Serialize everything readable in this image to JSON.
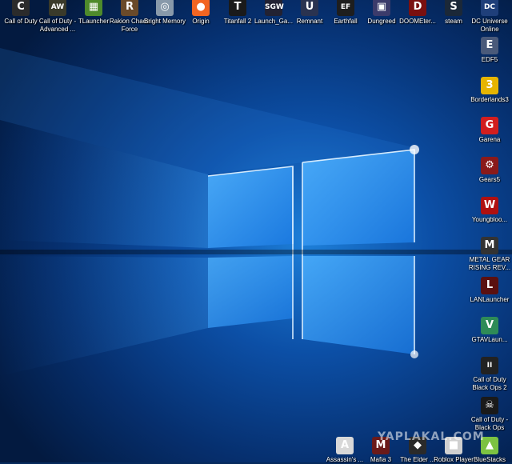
{
  "desktop": {
    "top_icons": [
      {
        "label": "Call of Duty",
        "icon": "cod-icon",
        "color": "#2b2b2b",
        "glyph": "C"
      },
      {
        "label": "Call of Duty - Advanced ...",
        "icon": "cod-aw-icon",
        "color": "#3a3a2a",
        "glyph": "AW"
      },
      {
        "label": "TLauncher",
        "icon": "minecraft-block-icon",
        "color": "#4e8a2b",
        "glyph": "▦"
      },
      {
        "label": "Rakion Chaos Force",
        "icon": "rakion-icon",
        "color": "#6a4a2a",
        "glyph": "R"
      },
      {
        "label": "Bright Memory",
        "icon": "bright-memory-icon",
        "color": "#8899aa",
        "glyph": "◎"
      },
      {
        "label": "Origin",
        "icon": "origin-icon",
        "color": "#f26522",
        "glyph": "●"
      },
      {
        "label": "Titanfall 2",
        "icon": "titanfall-icon",
        "color": "#1a1a1a",
        "glyph": "T"
      },
      {
        "label": "Launch_Ga...",
        "icon": "sgw-icon",
        "color": "#222233",
        "glyph": "SGW"
      },
      {
        "label": "Remnant",
        "icon": "unreal-icon",
        "color": "#2a3350",
        "glyph": "U"
      },
      {
        "label": "Earthfall",
        "icon": "earthfall-icon",
        "color": "#1e1e1e",
        "glyph": "EF"
      },
      {
        "label": "Dungreed",
        "icon": "dungreed-icon",
        "color": "#3b3b6b",
        "glyph": "▣"
      },
      {
        "label": "DOOMEter...",
        "icon": "doom-icon",
        "color": "#7a1010",
        "glyph": "D"
      },
      {
        "label": "steam",
        "icon": "steam-icon",
        "color": "#1b2838",
        "glyph": "S"
      },
      {
        "label": "DC Universe Online",
        "icon": "dc-icon",
        "color": "#1f3f7a",
        "glyph": "DC"
      }
    ],
    "right_icons": [
      {
        "label": "EDF5",
        "icon": "edf5-icon",
        "color": "#4a5a7a",
        "glyph": "E"
      },
      {
        "label": "Borderlands3",
        "icon": "borderlands-icon",
        "color": "#e6b400",
        "glyph": "3"
      },
      {
        "label": "Garena",
        "icon": "garena-icon",
        "color": "#d21e1e",
        "glyph": "G"
      },
      {
        "label": "Gears5",
        "icon": "gears-icon",
        "color": "#8a1a1a",
        "glyph": "⚙"
      },
      {
        "label": "Youngbloo...",
        "icon": "youngblood-icon",
        "color": "#b01010",
        "glyph": "W"
      },
      {
        "label": "METAL GEAR RISING REV...",
        "icon": "mgr-icon",
        "color": "#333333",
        "glyph": "M"
      },
      {
        "label": "LANLauncher",
        "icon": "lanlauncher-icon",
        "color": "#5a1010",
        "glyph": "L"
      },
      {
        "label": "GTAVLaun...",
        "icon": "gtav-icon",
        "color": "#2e8b57",
        "glyph": "V"
      },
      {
        "label": "Call of Duty Black Ops 2",
        "icon": "bo2-icon",
        "color": "#222222",
        "glyph": "II"
      },
      {
        "label": "Call of Duty - Black Ops",
        "icon": "bo-icon",
        "color": "#1a1a1a",
        "glyph": "☠"
      },
      {
        "label": "BlueStacks",
        "icon": "bluestacks-icon",
        "color": "#7cc242",
        "glyph": "▲"
      }
    ],
    "bottom_icons": [
      {
        "label": "Assassin's ...",
        "icon": "assassins-creed-icon",
        "color": "#d8d8d8",
        "glyph": "A"
      },
      {
        "label": "Mafia 3",
        "icon": "mafia-icon",
        "color": "#6a1a1a",
        "glyph": "M"
      },
      {
        "label": "The Elder ...",
        "icon": "skyrim-icon",
        "color": "#2a2a2a",
        "glyph": "◆"
      },
      {
        "label": "Roblox Player",
        "icon": "roblox-icon",
        "color": "#d0d0d0",
        "glyph": "■"
      }
    ]
  },
  "watermark": "YAPLAKAL.COM"
}
